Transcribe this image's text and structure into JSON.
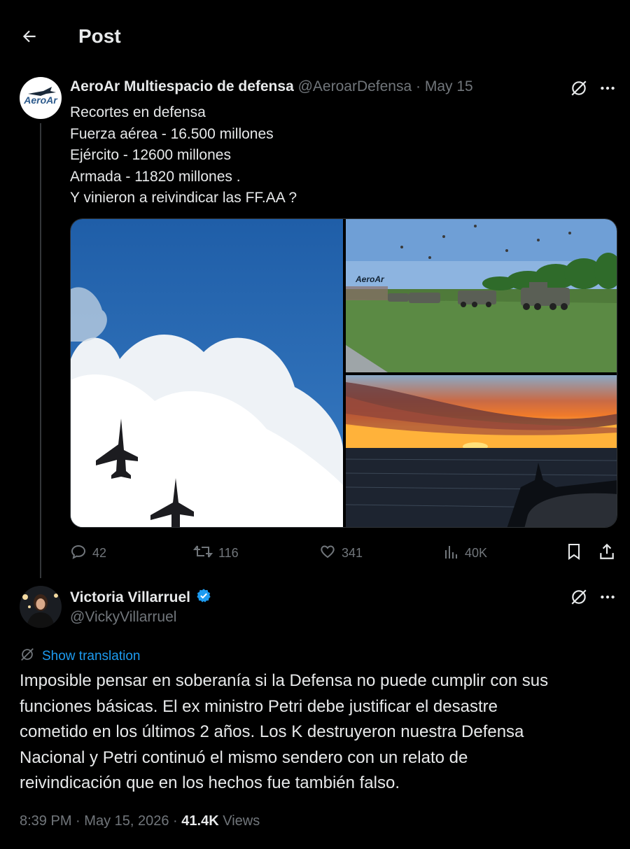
{
  "header": {
    "title": "Post"
  },
  "quoted_tweet": {
    "author_name": "AeroAr Multiespacio de defensa",
    "handle": "@AeroarDefensa",
    "separator": "·",
    "date": "May 15",
    "avatar_text": "AeroAr",
    "text_lines": [
      "Recortes en defensa",
      "Fuerza aérea - 16.500 millones",
      "Ejército - 12600 millones",
      "Armada - 11820 millones .",
      "Y vinieron a reivindicar las FF.AA ?"
    ],
    "media": {
      "watermark": "AeroAr"
    },
    "stats": {
      "replies": "42",
      "reposts": "116",
      "likes": "341",
      "views": "40K"
    }
  },
  "main_tweet": {
    "author_name": "Victoria Villarruel",
    "handle": "@VickyVillarruel",
    "verified": true,
    "show_translation": "Show translation",
    "text_lines": [
      "Imposible pensar en soberanía si la Defensa no puede cumplir con sus",
      "funciones básicas. El ex ministro Petri debe justificar el desastre",
      "cometido en los últimos 2 años. Los K destruyeron nuestra Defensa",
      "Nacional y Petri continuó el mismo sendero con un relato de",
      "reivindicación que en los hechos fue también falso."
    ],
    "time": "8:39 PM",
    "separator": "·",
    "date": "May 15, 2026",
    "separator2": "·",
    "views_count": "41.4K",
    "views_label": "Views"
  },
  "colors": {
    "accent": "#1d9bf0",
    "muted": "#71767b",
    "text": "#e7e9ea",
    "background": "#000000"
  }
}
